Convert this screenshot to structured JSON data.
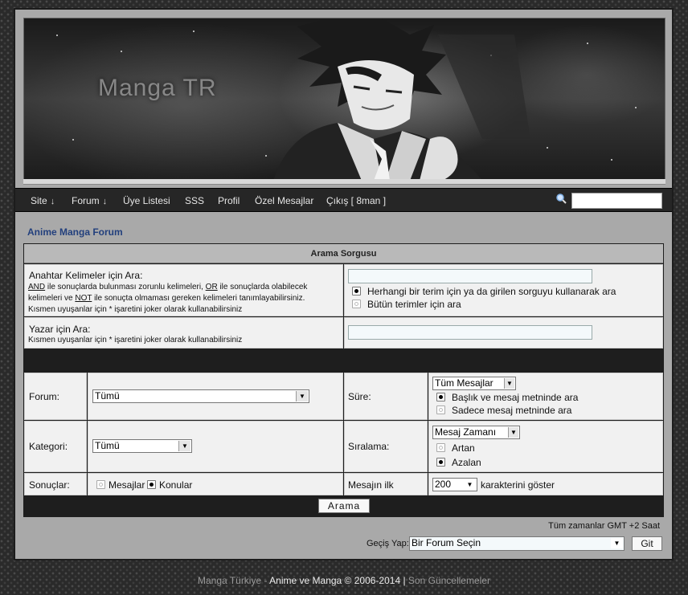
{
  "banner": {
    "logo_text": "Manga TR"
  },
  "nav": {
    "items": [
      {
        "label": "Site",
        "arrow": "↓"
      },
      {
        "label": "Forum",
        "arrow": "↓"
      },
      {
        "label": "Üye Listesi"
      },
      {
        "label": "SSS"
      },
      {
        "label": "Profil"
      },
      {
        "label": "Özel Mesajlar"
      },
      {
        "label": "Çıkış [ 8man ]"
      }
    ],
    "search_value": ""
  },
  "page": {
    "forum_title": "Anime Manga Forum"
  },
  "search": {
    "header": "Arama Sorgusu",
    "keywords": {
      "title": "Anahtar Kelimeler için Ara:",
      "help_and": "AND",
      "help_1": " ile sonuçlarda bulunması zorunlu kelimeleri, ",
      "help_or": "OR",
      "help_2": " ile sonuçlarda olabilecek",
      "help_3": "kelimeleri ve ",
      "help_not": "NOT",
      "help_4": " ile sonuçta olmaması gereken kelimeleri tanımlayabilirsiniz.",
      "help_5": "Kısmen uyuşanlar için * işaretini joker olarak kullanabilirsiniz",
      "value": "",
      "option_any": "Herhangi bir terim için ya da girilen sorguyu kullanarak ara",
      "option_all": "Bütün terimler için ara"
    },
    "author": {
      "title": "Yazar için Ara:",
      "help": "Kısmen uyuşanlar için * işaretini joker olarak kullanabilirsiniz",
      "value": ""
    },
    "forum": {
      "label": "Forum:",
      "selected": "Tümü"
    },
    "time": {
      "label": "Süre:",
      "selected": "Tüm Mesajlar",
      "option_title_text": "Başlık ve mesaj metninde ara",
      "option_text_only": "Sadece mesaj metninde ara"
    },
    "category": {
      "label": "Kategori:",
      "selected": "Tümü"
    },
    "sort": {
      "label": "Sıralama:",
      "selected": "Mesaj Zamanı",
      "option_asc": "Artan",
      "option_desc": "Azalan"
    },
    "results": {
      "label": "Sonuçlar:",
      "option_posts": "Mesajlar",
      "option_topics": "Konular"
    },
    "chars": {
      "label": "Mesajın ilk",
      "selected": "200",
      "suffix": "karakterini göster"
    },
    "submit_label": "Arama"
  },
  "timezone": "Tüm zamanlar GMT +2 Saat",
  "jump": {
    "label": "Geçiş Yap:",
    "selected": "Bir Forum Seçin",
    "go_label": "Git"
  },
  "footer": {
    "site": "Manga Türkiye",
    "sep1": " - ",
    "tagline": "Anime ve Manga © 2006-2014",
    "sep2": " | ",
    "updates": "Son Güncellemeler"
  }
}
